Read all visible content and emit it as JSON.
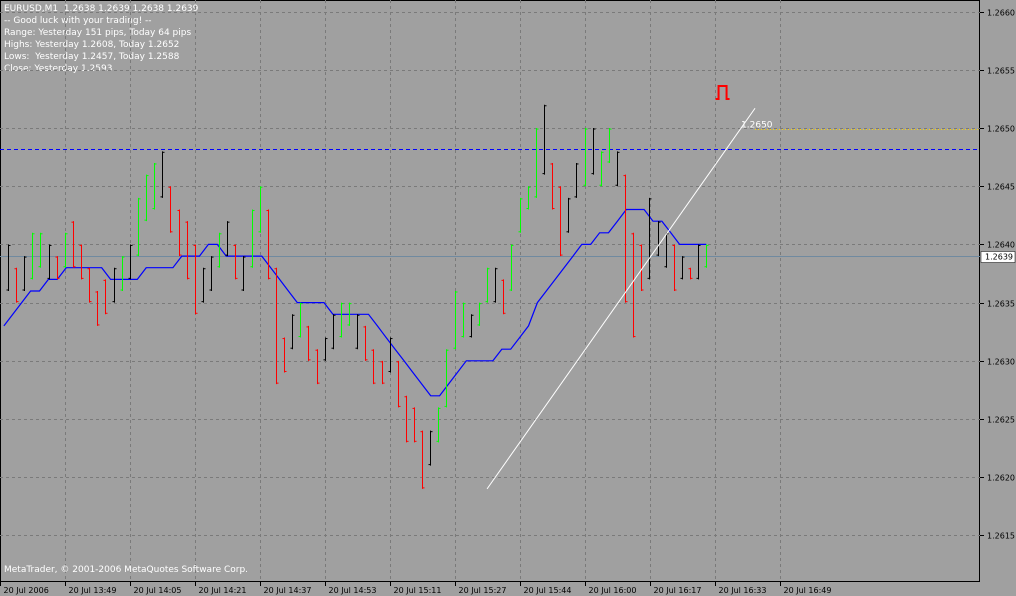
{
  "header": {
    "symbol_line": "EURUSD,M1  1.2638 1.2639 1.2638 1.2639",
    "greeting": "-- Good luck with your trading! --",
    "range": "Range: Yesterday 151 pips, Today 64 pips",
    "highs": "Highs: Yesterday 1.2608, Today 1.2652",
    "lows": "Lows:  Yesterday 1.2457, Today 1.2588",
    "close": "Close: Yesterday 1.2593"
  },
  "footer": {
    "copyright": "MetaTrader, © 2001-2006 MetaQuotes Software Corp."
  },
  "colors": {
    "background": "#a0a0a0",
    "grid": "#7a7a7a",
    "bull": "#00ff00",
    "bear": "#ff0000",
    "neutral": "#000000",
    "moving_average": "#0000ff",
    "resistance": "#0000ff",
    "current_price_line": "#708aa0",
    "trendline": "#ffffff",
    "projection": "#ffd700",
    "signal": "#ff0000"
  },
  "chart_data": {
    "type": "ohlc",
    "ylim": [
      1.2611,
      1.2661
    ],
    "y_ticks": [
      "1.2660",
      "1.2655",
      "1.2650",
      "1.2645",
      "1.2640",
      "1.2635",
      "1.2630",
      "1.2625",
      "1.2620",
      "1.2615"
    ],
    "x_labels": [
      "20 Jul 2006",
      "20 Jul 13:49",
      "20 Jul 14:05",
      "20 Jul 14:21",
      "20 Jul 14:37",
      "20 Jul 14:53",
      "20 Jul 15:11",
      "20 Jul 15:27",
      "20 Jul 15:44",
      "20 Jul 16:00",
      "20 Jul 16:17",
      "20 Jul 16:33",
      "20 Jul 16:49"
    ],
    "current_price": "1.2639",
    "resistance_level": 1.26482,
    "trendline": {
      "from": [
        1.2619
      ],
      "to": [
        1.26517
      ]
    },
    "trendline_label": "1.2650",
    "projection_level": 1.26499,
    "moving_average": [
      1.2633,
      1.2634,
      1.2635,
      1.2636,
      1.2636,
      1.2637,
      1.2637,
      1.2638,
      1.2638,
      1.2638,
      1.2638,
      1.2638,
      1.2637,
      1.2637,
      1.2637,
      1.2637,
      1.2638,
      1.2638,
      1.2638,
      1.2638,
      1.2639,
      1.2639,
      1.2639,
      1.264,
      1.264,
      1.2639,
      1.2639,
      1.2639,
      1.2639,
      1.2639,
      1.2638,
      1.2637,
      1.2636,
      1.2635,
      1.2635,
      1.2635,
      1.2635,
      1.2634,
      1.2634,
      1.2634,
      1.2634,
      1.2634,
      1.2633,
      1.2632,
      1.2631,
      1.263,
      1.2629,
      1.2628,
      1.2627,
      1.2627,
      1.2628,
      1.2629,
      1.263,
      1.263,
      1.263,
      1.263,
      1.2631,
      1.2631,
      1.2632,
      1.2633,
      1.2635,
      1.2636,
      1.2637,
      1.2638,
      1.2639,
      1.264,
      1.264,
      1.2641,
      1.2641,
      1.2642,
      1.2643,
      1.2643,
      1.2643,
      1.2642,
      1.2642,
      1.2641,
      1.264,
      1.264,
      1.264,
      1.264
    ],
    "bars": [
      [
        1.264,
        1.2636,
        "n"
      ],
      [
        1.2638,
        1.2635,
        "r"
      ],
      [
        1.2639,
        1.2636,
        "n"
      ],
      [
        1.2641,
        1.2637,
        "g"
      ],
      [
        1.2641,
        1.2638,
        "g"
      ],
      [
        1.264,
        1.2637,
        "n"
      ],
      [
        1.2639,
        1.2637,
        "r"
      ],
      [
        1.2641,
        1.2638,
        "g"
      ],
      [
        1.2642,
        1.2638,
        "r"
      ],
      [
        1.264,
        1.2637,
        "r"
      ],
      [
        1.2638,
        1.2635,
        "r"
      ],
      [
        1.2636,
        1.2633,
        "r"
      ],
      [
        1.2637,
        1.2634,
        "r"
      ],
      [
        1.2638,
        1.2635,
        "n"
      ],
      [
        1.2639,
        1.2636,
        "g"
      ],
      [
        1.264,
        1.2637,
        "n"
      ],
      [
        1.2644,
        1.2639,
        "g"
      ],
      [
        1.2646,
        1.2642,
        "g"
      ],
      [
        1.2647,
        1.2643,
        "g"
      ],
      [
        1.2648,
        1.2644,
        "n"
      ],
      [
        1.2645,
        1.2641,
        "r"
      ],
      [
        1.2643,
        1.2639,
        "r"
      ],
      [
        1.2642,
        1.2637,
        "r"
      ],
      [
        1.264,
        1.2634,
        "r"
      ],
      [
        1.2638,
        1.2635,
        "n"
      ],
      [
        1.2639,
        1.2636,
        "n"
      ],
      [
        1.2641,
        1.2638,
        "g"
      ],
      [
        1.2642,
        1.2639,
        "n"
      ],
      [
        1.264,
        1.2637,
        "r"
      ],
      [
        1.2639,
        1.2636,
        "n"
      ],
      [
        1.2643,
        1.2638,
        "g"
      ],
      [
        1.2645,
        1.2641,
        "g"
      ],
      [
        1.2643,
        1.2637,
        "r"
      ],
      [
        1.2638,
        1.2628,
        "r"
      ],
      [
        1.2632,
        1.2629,
        "r"
      ],
      [
        1.2634,
        1.2631,
        "n"
      ],
      [
        1.2635,
        1.2632,
        "g"
      ],
      [
        1.2633,
        1.263,
        "r"
      ],
      [
        1.2631,
        1.2628,
        "r"
      ],
      [
        1.2632,
        1.263,
        "n"
      ],
      [
        1.2634,
        1.2631,
        "n"
      ],
      [
        1.2635,
        1.2632,
        "g"
      ],
      [
        1.2635,
        1.2633,
        "g"
      ],
      [
        1.2634,
        1.2631,
        "n"
      ],
      [
        1.2633,
        1.263,
        "r"
      ],
      [
        1.2631,
        1.2628,
        "r"
      ],
      [
        1.263,
        1.2628,
        "r"
      ],
      [
        1.2632,
        1.2629,
        "n"
      ],
      [
        1.263,
        1.2626,
        "r"
      ],
      [
        1.2627,
        1.2623,
        "r"
      ],
      [
        1.2626,
        1.2623,
        "r"
      ],
      [
        1.2624,
        1.2619,
        "r"
      ],
      [
        1.2624,
        1.2621,
        "n"
      ],
      [
        1.2626,
        1.2623,
        "g"
      ],
      [
        1.2631,
        1.2626,
        "g"
      ],
      [
        1.2636,
        1.2631,
        "g"
      ],
      [
        1.2635,
        1.2632,
        "g"
      ],
      [
        1.2634,
        1.2632,
        "n"
      ],
      [
        1.2635,
        1.2633,
        "g"
      ],
      [
        1.2638,
        1.2635,
        "g"
      ],
      [
        1.2638,
        1.2635,
        "n"
      ],
      [
        1.2637,
        1.2634,
        "r"
      ],
      [
        1.264,
        1.2636,
        "g"
      ],
      [
        1.2644,
        1.2641,
        "g"
      ],
      [
        1.2645,
        1.2643,
        "g"
      ],
      [
        1.265,
        1.2644,
        "g"
      ],
      [
        1.2652,
        1.2646,
        "n"
      ],
      [
        1.2647,
        1.2643,
        "r"
      ],
      [
        1.2645,
        1.2639,
        "r"
      ],
      [
        1.2644,
        1.2641,
        "n"
      ],
      [
        1.2647,
        1.2644,
        "n"
      ],
      [
        1.265,
        1.2645,
        "g"
      ],
      [
        1.265,
        1.2646,
        "n"
      ],
      [
        1.2648,
        1.2645,
        "g"
      ],
      [
        1.265,
        1.2647,
        "g"
      ],
      [
        1.2648,
        1.2645,
        "n"
      ],
      [
        1.2646,
        1.2635,
        "r"
      ],
      [
        1.2641,
        1.2632,
        "r"
      ],
      [
        1.264,
        1.2636,
        "r"
      ],
      [
        1.2644,
        1.2637,
        "n"
      ],
      [
        1.2642,
        1.2639,
        "n"
      ],
      [
        1.2641,
        1.2638,
        "n"
      ],
      [
        1.264,
        1.2636,
        "r"
      ],
      [
        1.2639,
        1.2637,
        "n"
      ],
      [
        1.2638,
        1.2637,
        "r"
      ],
      [
        1.264,
        1.2637,
        "n"
      ],
      [
        1.264,
        1.2638,
        "g"
      ]
    ]
  }
}
